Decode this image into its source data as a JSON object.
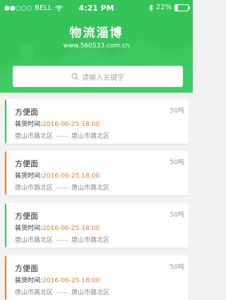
{
  "status_bar": {
    "carrier": "BELL",
    "time": "4:21 PM",
    "battery": "22%",
    "signal_dots": "●●○○○"
  },
  "header": {
    "title": "物流淄博",
    "url": "www.560533.com.cn"
  },
  "search": {
    "placeholder": "请输入关键字"
  },
  "colors": {
    "header_green": "#35c45a",
    "accent_green": "#35c45a",
    "accent_orange": "#f07b2e"
  },
  "listings": [
    {
      "name": "方便面",
      "weight": "50吨",
      "time_label": "装货时间:",
      "time_value": "2016-06-25  18:00",
      "from": "唐山市路北区",
      "sep": "——",
      "to": "唐山市路北区",
      "accent": "#35c45a"
    },
    {
      "name": "方便面",
      "weight": "50吨",
      "time_label": "装货时间:",
      "time_value": "2016-06-25  18:00",
      "from": "唐山市路北区",
      "sep": "——",
      "to": "唐山市路北区",
      "accent": "#f07b2e"
    },
    {
      "name": "方便面",
      "weight": "50吨",
      "time_label": "装货时间:",
      "time_value": "2016-06-25  18:00",
      "from": "唐山市路北区",
      "sep": "——",
      "to": "唐山市路北区",
      "accent": "#35c45a"
    },
    {
      "name": "方便面",
      "weight": "50吨",
      "time_label": "装货时间:",
      "time_value": "2016-06-25  18:00",
      "from": "唐山市路北区",
      "sep": "——",
      "to": "唐山市路北区",
      "accent": "#f07b2e"
    }
  ]
}
